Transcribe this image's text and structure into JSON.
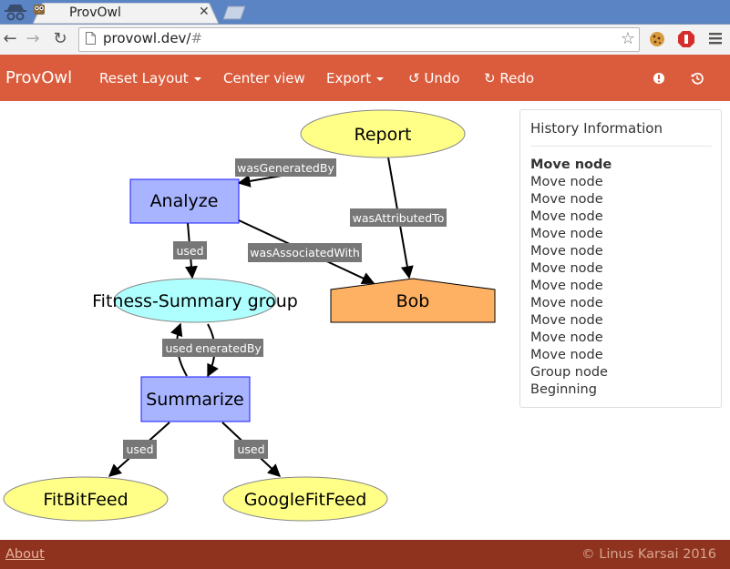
{
  "browser": {
    "tab_title": "ProvOwl",
    "url_host": "provowl.dev/",
    "url_hash": "#"
  },
  "navbar": {
    "brand": "ProvOwl",
    "reset_layout": "Reset Layout",
    "center_view": "Center view",
    "export": "Export",
    "undo": "Undo",
    "redo": "Redo"
  },
  "graph": {
    "nodes": {
      "report": "Report",
      "analyze": "Analyze",
      "fitness_group": "Fitness-Summary group",
      "bob": "Bob",
      "summarize": "Summarize",
      "fitbitfeed": "FitBitFeed",
      "googlefitfeed": "GoogleFitFeed"
    },
    "edges": {
      "was_generated_by": "wasGeneratedBy",
      "was_attributed_to": "wasAttributedTo",
      "used_analyze": "used",
      "was_associated_with": "wasAssociatedWith",
      "used_summarize": "used",
      "generated_by_summarize": "eneratedBy",
      "used_fitbit": "used",
      "used_googlefit": "used"
    },
    "colors": {
      "entity": "#ffff88",
      "activity": "#a8b4ff",
      "agent": "#ffb163",
      "group": "#b0ffff",
      "edge_label_bg": "#777777"
    }
  },
  "history": {
    "title": "History Information",
    "items": [
      "Move node",
      "Move node",
      "Move node",
      "Move node",
      "Move node",
      "Move node",
      "Move node",
      "Move node",
      "Move node",
      "Move node",
      "Move node",
      "Move node",
      "Group node",
      "Beginning"
    ],
    "active_index": 0
  },
  "footer": {
    "about": "About",
    "copyright": "© Linus Karsai 2016"
  }
}
